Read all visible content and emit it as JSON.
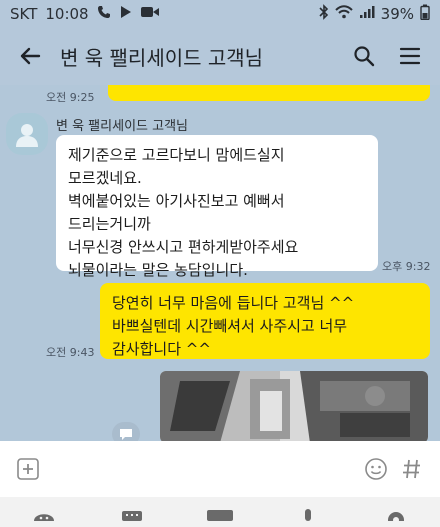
{
  "status": {
    "carrier": "SKT",
    "time": "10:08",
    "battery": "39%"
  },
  "header": {
    "title": "변  욱 팰리세이드 고객님"
  },
  "messages": {
    "top_time": "오전 9:25",
    "sender_name": "변  욱 팰리세이드 고객님",
    "other_lines": [
      "제기준으로 고르다보니 맘에드실지",
      "모르겠네요.",
      "벽에붙어있는 아기사진보고 예뻐서",
      "드리는거니까",
      "너무신경 안쓰시고 편하게받아주세요",
      "뇌물이라는 말은 농담입니다."
    ],
    "other_time": "오후 9:32",
    "me_lines": [
      "당연히 너무 마음에 듭니다 고객님 ^^",
      "바쁘실텐데 시간빼셔서 사주시고 너무",
      "감사합니다 ^^"
    ],
    "me_time": "오전 9:43"
  },
  "input": {
    "placeholder": ""
  },
  "colors": {
    "chat_bg": "#b2c7d9",
    "my_bubble": "#fee500",
    "other_bubble": "#ffffff"
  },
  "tray": {
    "items": [
      "emoticon-icon",
      "keyboard-icon",
      "gif-icon",
      "mic-icon",
      "settings-icon"
    ],
    "gif_label": "GIF"
  }
}
